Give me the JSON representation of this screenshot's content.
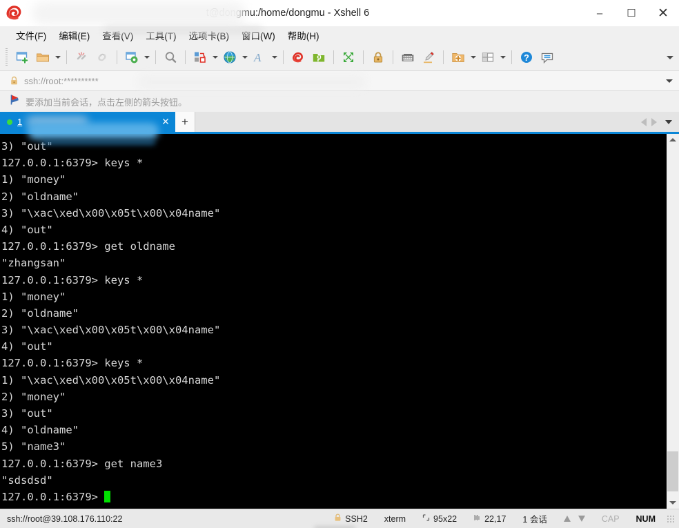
{
  "window": {
    "title": "t@dongmu:/home/dongmu - Xshell 6",
    "logo_icon": "xshell-spiral-logo",
    "controls": {
      "minimize": "–",
      "maximize": "☐",
      "close": "✕"
    }
  },
  "menubar": {
    "items": [
      {
        "label": "文件(F)",
        "name": "menu-file"
      },
      {
        "label": "编辑(E)",
        "name": "menu-edit"
      },
      {
        "label": "查看(V)",
        "name": "menu-view"
      },
      {
        "label": "工具(T)",
        "name": "menu-tools"
      },
      {
        "label": "选项卡(B)",
        "name": "menu-tabs"
      },
      {
        "label": "窗口(W)",
        "name": "menu-window"
      },
      {
        "label": "帮助(H)",
        "name": "menu-help"
      }
    ]
  },
  "toolbar": {
    "buttons": [
      "new-session-icon",
      "open-folder-icon",
      "disconnect-icon",
      "reconnect-icon",
      "session-properties-icon",
      "find-icon",
      "file-transfer-icon",
      "browser-icon",
      "font-icon",
      "xshell-icon",
      "xftp-icon",
      "fullscreen-icon",
      "lock-icon",
      "keyboard-icon",
      "highlight-icon",
      "new-folder-icon",
      "layout-icon",
      "help-icon",
      "chat-icon"
    ],
    "overflow_icon": "toolbar-overflow-caret"
  },
  "address": {
    "lock_icon": "lock-icon",
    "value": "ssh://root:**********",
    "dropdown_icon": "chevron-down-icon"
  },
  "notice": {
    "icon": "flag-icon",
    "text": "要添加当前会话，点击左侧的箭头按钮。"
  },
  "tabs": {
    "active": {
      "status_icon": "connected-dot",
      "label": "1",
      "close_icon": "close-icon"
    },
    "new_tab_label": "+",
    "nav": {
      "prev_icon": "triangle-left-icon",
      "next_icon": "triangle-right-icon",
      "menu_icon": "chevron-down-icon"
    }
  },
  "terminal": {
    "prompt": "127.0.0.1:6379>",
    "lines": [
      "3) \"out\"",
      "127.0.0.1:6379> keys *",
      "1) \"money\"",
      "2) \"oldname\"",
      "3) \"\\xac\\xed\\x00\\x05t\\x00\\x04name\"",
      "4) \"out\"",
      "127.0.0.1:6379> get oldname",
      "\"zhangsan\"",
      "127.0.0.1:6379> keys *",
      "1) \"money\"",
      "2) \"oldname\"",
      "3) \"\\xac\\xed\\x00\\x05t\\x00\\x04name\"",
      "4) \"out\"",
      "127.0.0.1:6379> keys *",
      "1) \"\\xac\\xed\\x00\\x05t\\x00\\x04name\"",
      "2) \"money\"",
      "3) \"out\"",
      "4) \"oldname\"",
      "5) \"name3\"",
      "127.0.0.1:6379> get name3",
      "\"sdsdsd\"",
      "127.0.0.1:6379> "
    ],
    "cursor_color": "#00e000",
    "background": "#000000",
    "foreground": "#d8d8d8"
  },
  "scrollbar": {
    "up_icon": "scroll-up-arrow",
    "down_icon": "scroll-down-arrow"
  },
  "statusbar": {
    "connection": "ssh://root@39.108.176.110:22",
    "security_icon": "lock-icon",
    "security": "SSH2",
    "terminal_type": "xterm",
    "size_icon": "size-icon",
    "size": "95x22",
    "cursor_icon": "cursor-icon",
    "cursor_pos": "22,17",
    "sessions": "1 会话",
    "transfer_up_icon": "arrow-up-icon",
    "transfer_down_icon": "arrow-down-icon",
    "cap": "CAP",
    "num": "NUM",
    "resize_grip": "resize-grip-icon"
  },
  "colors": {
    "accent": "#0b86d6",
    "tab_active_bg": "#0b86d6",
    "terminal_bg": "#000000",
    "terminal_fg": "#d8d8d8",
    "cursor": "#00e000",
    "chrome_bg": "#f0f0f0"
  }
}
